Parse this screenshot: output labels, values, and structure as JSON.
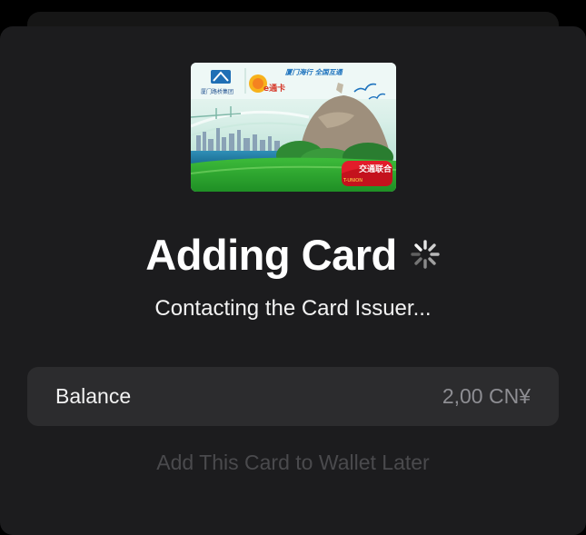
{
  "card_image": {
    "operator_text": "厦门路桥集团",
    "brand_text": "e通卡",
    "slogan_text": "厦门海行 全国互通",
    "badge_text": "交通联合",
    "badge_sub_text": "T-UNION"
  },
  "title": "Adding Card",
  "subtitle": "Contacting the Card Issuer...",
  "balance": {
    "label": "Balance",
    "value": "2,00 CN¥"
  },
  "later_link": "Add This Card to Wallet Later",
  "colors": {
    "sheet_background": "#1c1c1e",
    "row_background": "#2c2c2e",
    "secondary_text": "#8e8e93",
    "disabled_text": "#4a4a4d"
  }
}
